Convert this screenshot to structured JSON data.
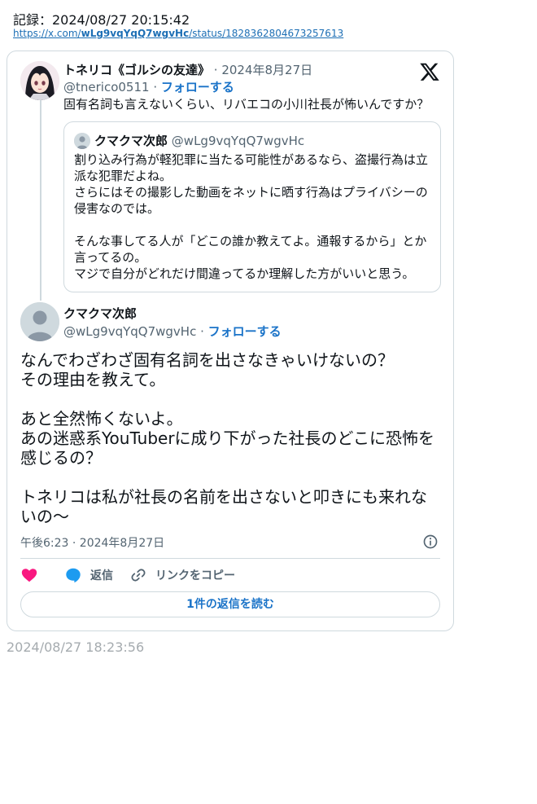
{
  "record": {
    "text": "記録：2024/08/27 20:15:42",
    "url_prefix": "https://x.com/",
    "url_user": "wLg9vqYqQ7wgvHc",
    "url_suffix": "/status/1828362804673257613"
  },
  "tweet1": {
    "display_name": "トネリコ《ゴルシの友達》",
    "date": "· 2024年8月27日",
    "handle": "@tnerico0511 ·",
    "follow_label": "フォローする",
    "text": "固有名詞も言えないくらい、リバエコの小川社長が怖いんですか？"
  },
  "quote": {
    "display_name": "クマクマ次郎",
    "handle": "@wLg9vqYqQ7wgvHc",
    "paragraphs": [
      "割り込み行為が軽犯罪に当たる可能性があるなら、盗撮行為は立\n派な犯罪だよね。\nさらにはその撮影した動画をネットに晒す行為はプライバシーの\n侵害なのでは。",
      "そんな事してる人が「どこの誰か教えてよ。通報するから」とか\n言ってるの。\nマジで自分がどれだけ間違ってるか理解した方がいいと思う。"
    ]
  },
  "tweet2": {
    "display_name": "クマクマ次郎",
    "handle": "@wLg9vqYqQ7wgvHc ·",
    "follow_label": "フォローする",
    "paragraphs": [
      "なんでわざわざ固有名詞を出さなきゃいけないの？\nその理由を教えて。",
      "あと全然怖くないよ。\nあの迷惑系YouTuberに成り下がった社長のどこに恐怖を\n感じるの？",
      "トネリコは私が社長の名前を出さないと叩きにも来れな\nいの〜"
    ],
    "timestamp": "午後6:23 · 2024年8月27日",
    "reply_label": "返信",
    "copy_label": "リンクをコピー",
    "read_replies_label": "1件の返信を読む"
  },
  "footer": {
    "timestamp": "2024/08/27 18:23:56"
  },
  "colors": {
    "accent": "#1d9bf0",
    "like": "#f91880",
    "muted": "#536471",
    "border": "#cfd9de"
  },
  "icons": [
    "x-logo-icon",
    "info-icon",
    "heart-icon",
    "reply-bubble-icon",
    "link-icon"
  ]
}
